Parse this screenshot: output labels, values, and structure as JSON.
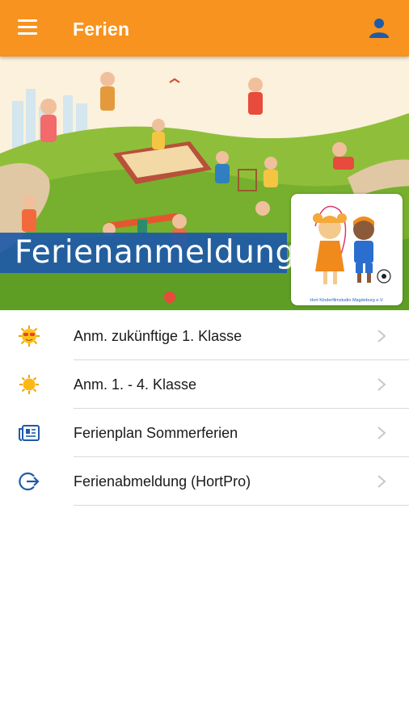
{
  "appbar": {
    "title": "Ferien",
    "menu_icon": "hamburger-menu-icon",
    "user_icon": "user-icon",
    "color": "#f7931e"
  },
  "hero": {
    "banner_text": "Ferienanmeldung",
    "banner_color": "#1e5aaa",
    "logo_caption": "Hort Kinderfilmstudio Magdeburg e.V."
  },
  "menu": {
    "items": [
      {
        "label": "Anm. zukünftige 1. Klasse",
        "icon": "sun-with-sunglasses-icon"
      },
      {
        "label": "Anm. 1. - 4. Klasse",
        "icon": "sun-icon"
      },
      {
        "label": "Ferienplan Sommerferien",
        "icon": "newspaper-icon"
      },
      {
        "label": "Ferienabmeldung (HortPro)",
        "icon": "sign-out-icon"
      }
    ],
    "chevron_icon": "chevron-right-icon"
  }
}
